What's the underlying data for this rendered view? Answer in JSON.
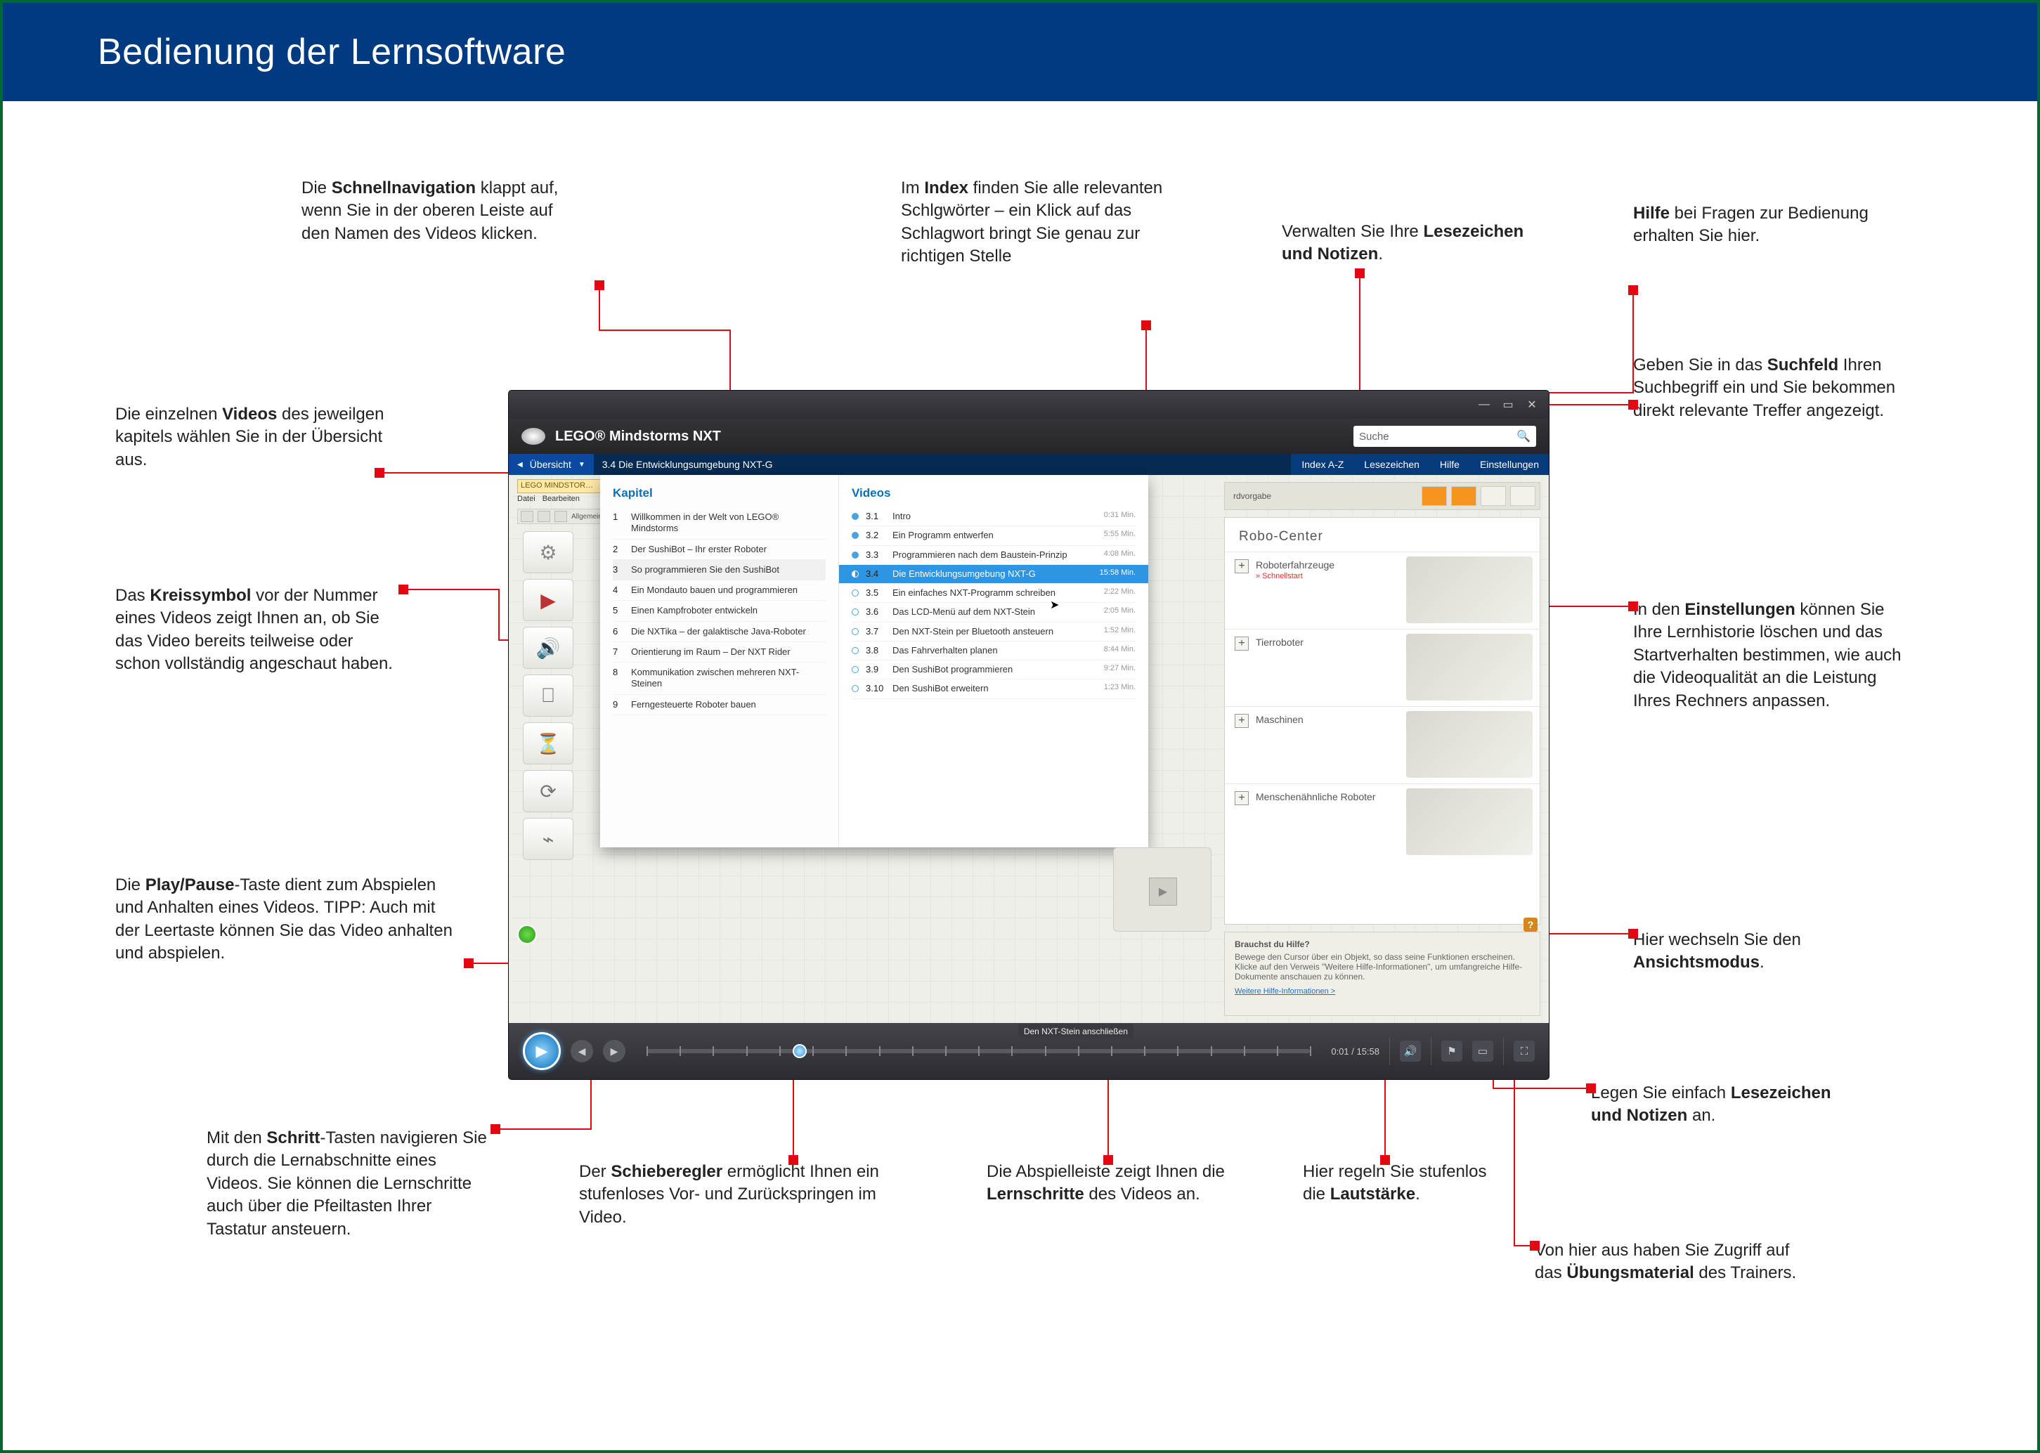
{
  "page_title": "Bedienung der Lernsoftware",
  "annotations": {
    "schnellnav": "Die <strong>Schnellnavigation</strong> klappt auf, wenn Sie in der oberen Leiste auf den Namen des Videos klicken.",
    "index": "Im <strong>Index</strong> finden Sie alle relevanten Schlgwörter – ein Klick auf das Schlagwort bringt Sie genau zur richtigen Stelle",
    "lesezeichen_top": "Verwalten Sie Ihre <strong>Lesezeichen und Notizen</strong>.",
    "hilfe": "<strong>Hilfe</strong> bei Fragen zur Bedienung erhalten Sie hier.",
    "suchfeld": "Geben Sie in das <strong>Suchfeld</strong> Ihren Suchbegriff ein und Sie bekommen direkt relevante Treffer angezeigt.",
    "videos": "Die einzelnen <strong>Videos</strong> des jeweilgen kapitels wählen Sie in der Übersicht aus.",
    "kreissymbol": "Das <strong>Kreissymbol</strong> vor der Nummer eines Videos zeigt Ihnen an, ob Sie das Video bereits teilweise oder schon vollständig ange­schaut haben.",
    "einstellungen": "In den <strong>Einstellungen</strong> können Sie Ihre Lernhistorie löschen und das Startverhalten be­stimmen, wie auch die Videoqualität an die Leistung Ihres Rechners anpassen.",
    "playpause": "Die <strong>Play/Pause</strong>-Taste dient zum Abspielen und Anhalten eines Videos. TIPP: Auch mit der Leertaste können Sie das Video anhalten und abspielen.",
    "ansicht": "Hier wechseln Sie den <strong>Ansichtsmodus</strong>.",
    "lesezeichen_bottom": "Legen Sie einfach <strong>Lesezeichen und Notizen</strong> an.",
    "schritt": "Mit den <strong>Schritt</strong>-Tasten navigieren Sie durch die Lernabschnitte eines Videos. Sie können die Lernschritte auch über die Pfeiltasten Ihrer Tastatur ansteuern.",
    "schieberegler": "Der <strong>Schieberegler</strong> ermöglicht Ihnen ein stufenloses Vor- und Zurückspringen im Video.",
    "lernschritte": "Die Abspielleiste zeigt Ihnen die <strong>Lernschritte</strong> des Videos an.",
    "lautstaerke": "Hier regeln Sie stufenlos die <strong>Lautstärke</strong>.",
    "uebungsmaterial": "Von hier aus haben Sie Zugriff auf das <strong>Übungsmaterial</strong> des Trainers."
  },
  "app": {
    "title": "LEGO® Mindstorms NXT",
    "search_placeholder": "Suche",
    "crumb_overview": "Übersicht",
    "crumb_current": "3.4 Die Entwicklungsumgebung NXT-G",
    "nav_tabs": [
      "Index A-Z",
      "Lesezeichen",
      "Hilfe",
      "Einstellungen"
    ],
    "sub_title": "LEGO MINDSTOR…",
    "sub_menu": [
      "Datei",
      "Bearbeiten"
    ],
    "sub_quick": "Allgemein",
    "dropdown": {
      "chapters_title": "Kapitel",
      "videos_title": "Videos",
      "chapters": [
        {
          "n": "1",
          "t": "Willkommen in der Welt von LEGO® Mindstorms"
        },
        {
          "n": "2",
          "t": "Der SushiBot – Ihr erster Roboter"
        },
        {
          "n": "3",
          "t": "So programmieren Sie den SushiBot"
        },
        {
          "n": "4",
          "t": "Ein Mondauto bauen und programmieren"
        },
        {
          "n": "5",
          "t": "Einen Kampfroboter entwickeln"
        },
        {
          "n": "6",
          "t": "Die NXTika – der galaktische Java-Roboter"
        },
        {
          "n": "7",
          "t": "Orientierung im Raum – Der NXT Rider"
        },
        {
          "n": "8",
          "t": "Kommunikation zwischen mehreren NXT-Steinen"
        },
        {
          "n": "9",
          "t": "Ferngesteuerte Roboter bauen"
        }
      ],
      "chapters_selected_index": 2,
      "videos": [
        {
          "m": "full",
          "n": "3.1",
          "t": "Intro",
          "d": "0:31 Min."
        },
        {
          "m": "full",
          "n": "3.2",
          "t": "Ein Programm entwerfen",
          "d": "5:55 Min."
        },
        {
          "m": "full",
          "n": "3.3",
          "t": "Programmieren nach dem Baustein-Prinzip",
          "d": "4:08 Min."
        },
        {
          "m": "half",
          "n": "3.4",
          "t": "Die Entwicklungsumgebung NXT-G",
          "d": "15:58 Min."
        },
        {
          "m": "",
          "n": "3.5",
          "t": "Ein einfaches NXT-Programm schreiben",
          "d": "2:22 Min."
        },
        {
          "m": "",
          "n": "3.6",
          "t": "Das LCD-Menü auf dem NXT-Stein",
          "d": "2:05 Min."
        },
        {
          "m": "",
          "n": "3.7",
          "t": "Den NXT-Stein per Bluetooth ansteuern",
          "d": "1:52 Min."
        },
        {
          "m": "",
          "n": "3.8",
          "t": "Das Fahrverhalten planen",
          "d": "8:44 Min."
        },
        {
          "m": "",
          "n": "3.9",
          "t": "Den SushiBot programmieren",
          "d": "9:27 Min."
        },
        {
          "m": "",
          "n": "3.10",
          "t": "Den SushiBot erweitern",
          "d": "1:23 Min."
        }
      ],
      "videos_active_index": 3
    },
    "rtop_label": "rdvorgabe",
    "robo": {
      "title": "Robo-Center",
      "cats": [
        {
          "l": "Roboterfahrzeuge",
          "s": "Schnellstart"
        },
        {
          "l": "Tierroboter",
          "s": ""
        },
        {
          "l": "Maschinen",
          "s": ""
        },
        {
          "l": "Menschenähnliche Roboter",
          "s": ""
        }
      ]
    },
    "help": {
      "title": "Brauchst du Hilfe?",
      "body": "Bewege den Cursor über ein Objekt, so dass seine Funktionen erscheinen. Klicke auf den Verweis \"Weitere Hilfe-Informationen\", um umfangreiche Hilfe-Dokumente anschauen zu können.",
      "link": "Weitere Hilfe-Informationen >"
    },
    "playbar": {
      "tooltip": "Den NXT-Stein anschließen",
      "time": "0:01 / 15:58"
    }
  }
}
